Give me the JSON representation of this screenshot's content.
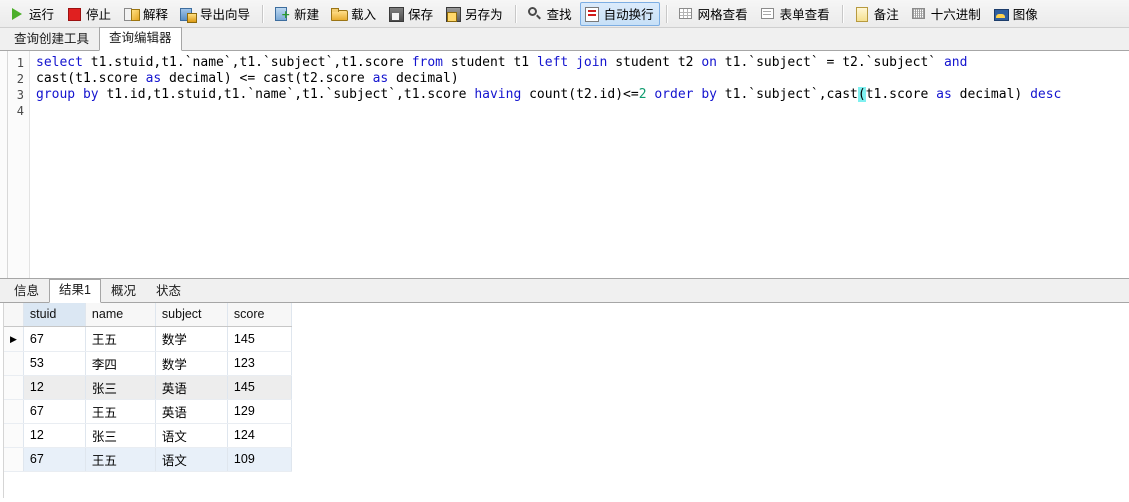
{
  "toolbar": {
    "groups": [
      [
        {
          "icon": "run-icon",
          "icon_class": "ico-run",
          "label": "运行",
          "active": false
        },
        {
          "icon": "stop-icon",
          "icon_class": "ico-stop",
          "label": "停止",
          "active": false
        },
        {
          "icon": "explain-icon",
          "icon_class": "ico-explain",
          "label": "解释",
          "active": false
        },
        {
          "icon": "export-wizard-icon",
          "icon_class": "ico-export",
          "label": "导出向导",
          "active": false
        }
      ],
      [
        {
          "icon": "new-icon",
          "icon_class": "ico-new",
          "label": "新建",
          "active": false
        },
        {
          "icon": "load-icon",
          "icon_class": "ico-load",
          "label": "载入",
          "active": false
        },
        {
          "icon": "save-icon",
          "icon_class": "ico-save",
          "label": "保存",
          "active": false
        },
        {
          "icon": "save-as-icon",
          "icon_class": "ico-saveas",
          "label": "另存为",
          "active": false
        }
      ],
      [
        {
          "icon": "search-icon",
          "icon_class": "ico-find",
          "label": "查找",
          "active": false
        },
        {
          "icon": "word-wrap-icon",
          "icon_class": "ico-wrap",
          "label": "自动换行",
          "active": true
        }
      ],
      [
        {
          "icon": "grid-view-icon",
          "icon_class": "ico-grid",
          "label": "网格查看",
          "active": false
        },
        {
          "icon": "form-view-icon",
          "icon_class": "ico-form",
          "label": "表单查看",
          "active": false
        }
      ],
      [
        {
          "icon": "memo-icon",
          "icon_class": "ico-memo",
          "label": "备注",
          "active": false
        },
        {
          "icon": "hex-icon",
          "icon_class": "ico-hex",
          "label": "十六进制",
          "active": false
        },
        {
          "icon": "image-icon",
          "icon_class": "ico-image",
          "label": "图像",
          "active": false
        }
      ]
    ],
    "accent_color": "#c7e0f7"
  },
  "top_tabs": [
    {
      "label": "查询创建工具",
      "selected": false
    },
    {
      "label": "查询编辑器",
      "selected": true
    }
  ],
  "editor": {
    "line_numbers": [
      "1",
      "2",
      "3",
      "4"
    ],
    "lines": [
      "select t1.stuid,t1.`name`,t1.`subject`,t1.score from student t1 left join student t2 on t1.`subject` = t2.`subject` and",
      "cast(t1.score as decimal) <= cast(t2.score as decimal)",
      "group by t1.id,t1.stuid,t1.`name`,t1.`subject`,t1.score having count(t2.id)<=2 order by t1.`subject`,cast(t1.score as decimal) desc",
      ""
    ],
    "keyword_color": "#1414cf",
    "number_color": "#0f9b6e",
    "bracket_match_color": "#7ff0f0"
  },
  "bottom_tabs": [
    {
      "label": "信息",
      "selected": false
    },
    {
      "label": "结果1",
      "selected": true
    },
    {
      "label": "概况",
      "selected": false
    },
    {
      "label": "状态",
      "selected": false
    }
  ],
  "result_grid": {
    "columns": [
      "stuid",
      "name",
      "subject",
      "score"
    ],
    "selected_column": "stuid",
    "current_row_marker": "▶",
    "rows": [
      {
        "stuid": "67",
        "name": "王五",
        "subject": "数学",
        "score": "145",
        "current": true,
        "style": "normal"
      },
      {
        "stuid": "53",
        "name": "李四",
        "subject": "数学",
        "score": "123",
        "current": false,
        "style": "normal"
      },
      {
        "stuid": "12",
        "name": "张三",
        "subject": "英语",
        "score": "145",
        "current": false,
        "style": "alt"
      },
      {
        "stuid": "67",
        "name": "王五",
        "subject": "英语",
        "score": "129",
        "current": false,
        "style": "normal"
      },
      {
        "stuid": "12",
        "name": "张三",
        "subject": "语文",
        "score": "124",
        "current": false,
        "style": "normal"
      },
      {
        "stuid": "67",
        "name": "王五",
        "subject": "语文",
        "score": "109",
        "current": false,
        "style": "sel"
      }
    ]
  }
}
